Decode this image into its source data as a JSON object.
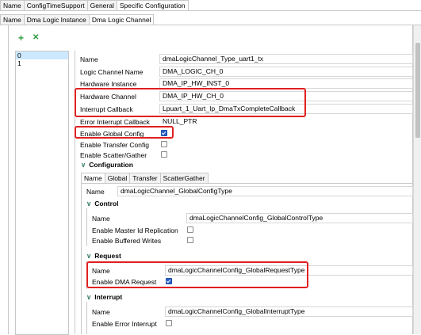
{
  "top_tabs": [
    "Name",
    "ConfigTimeSupport",
    "General",
    "Specific Configuration"
  ],
  "sub_tabs": [
    "Name",
    "Dma Logic Instance",
    "Dma Logic Channel"
  ],
  "toolbar": {
    "add_symbol": "+",
    "remove_symbol": "✕"
  },
  "list_items": [
    "0",
    "1"
  ],
  "props": {
    "name_label": "Name",
    "name_value": "dmaLogicChannel_Type_uart1_tx",
    "lcn_label": "Logic Channel Name",
    "lcn_value": "DMA_LOGIC_CH_0",
    "hwi_label": "Hardware Instance",
    "hwi_value": "DMA_IP_HW_INST_0",
    "hwc_label": "Hardware Channel",
    "hwc_value": "DMA_IP_HW_CH_0",
    "icb_label": "Interrupt Callback",
    "icb_value": "Lpuart_1_Uart_Ip_DmaTxCompleteCallback",
    "eicb_label": "Error Interrupt Callback",
    "eicb_value": "NULL_PTR",
    "egc_label": "Enable Global Config",
    "etc_label": "Enable Transfer Config",
    "esg_label": "Enable Scatter/Gather"
  },
  "configuration": {
    "title": "Configuration",
    "tabs": [
      "Name",
      "Global",
      "Transfer",
      "ScatterGather"
    ],
    "name_label": "Name",
    "name_value": "dmaLogicChannel_GlobalConfigType",
    "control": {
      "title": "Control",
      "name_label": "Name",
      "name_value": "dmaLogicChannelConfig_GlobalControlType",
      "emir_label": "Enable Master Id Replication",
      "ebw_label": "Enable Buffered Writes"
    },
    "request": {
      "title": "Request",
      "name_label": "Name",
      "name_value": "dmaLogicChannelConfig_GlobalRequestType",
      "edr_label": "Enable DMA Request"
    },
    "interrupt": {
      "title": "Interrupt",
      "name_label": "Name",
      "name_value": "dmaLogicChannelConfig_GlobalInterruptType",
      "eei_label": "Enable Error Interrupt"
    }
  },
  "checkbox_states": {
    "enable_global_config": true,
    "enable_transfer_config": false,
    "enable_scatter_gather": false,
    "enable_master_id_replication": false,
    "enable_buffered_writes": false,
    "enable_dma_request": true,
    "enable_error_interrupt": false
  },
  "colors": {
    "highlight_box": "#e02020",
    "checkbox_checked": "#2a62c9",
    "selected_row": "#cde8ff",
    "section_chevron": "#3a7d6d"
  }
}
